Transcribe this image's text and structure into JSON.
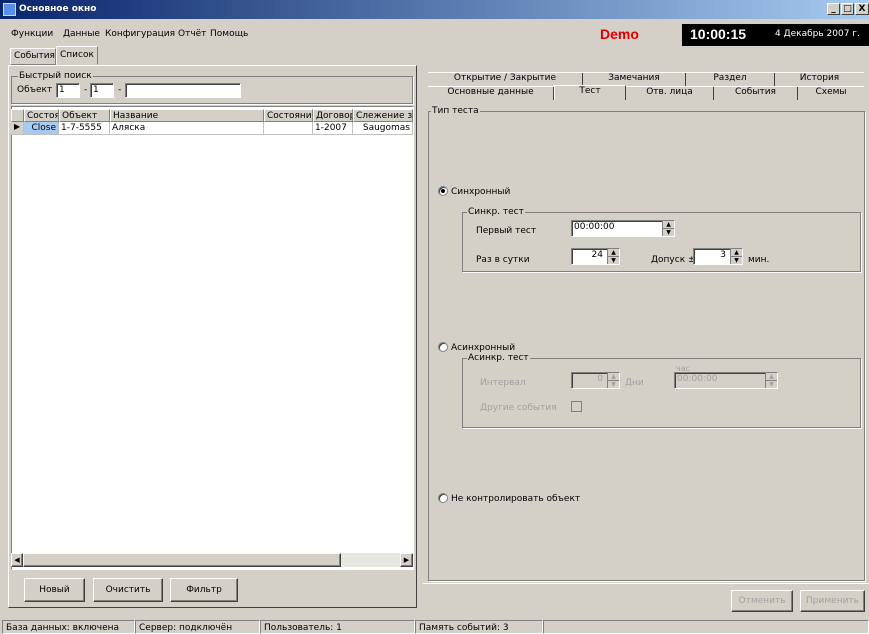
{
  "window": {
    "title": "Основное окно",
    "min": "_",
    "max": "□",
    "close": "X"
  },
  "menu": {
    "items": [
      "Функции",
      "Данные",
      "Конфигурация",
      "Отчёт",
      "Помощь"
    ]
  },
  "header": {
    "demo": "Demo",
    "time": "10:00:15",
    "date": "4 Декабрь 2007 г."
  },
  "view_tabs": [
    "События",
    "Список"
  ],
  "quick_search": {
    "legend": "Быстрый поиск",
    "label": "Объект",
    "f1": "1",
    "sep1": "-",
    "f2": "1",
    "sep2": "-",
    "f3": ""
  },
  "grid": {
    "columns": [
      "Состоя",
      "Объект",
      "Название",
      "Состояние",
      "Договор",
      "Слежение з"
    ],
    "rows": [
      [
        "Close",
        "1-7-5555",
        "Аляска",
        "",
        "1-2007",
        "Saugomas"
      ]
    ]
  },
  "left_buttons": {
    "new": "Новый",
    "clear": "Очистить",
    "filter": "Фильтр"
  },
  "right_tabs_row1": [
    "Открытие / Закрытие",
    "Замечания",
    "Раздел",
    "История"
  ],
  "right_tabs_row2": [
    "Основные данные",
    "Тест",
    "Отв. лица",
    "События",
    "Схемы"
  ],
  "test": {
    "type_legend": "Тип теста",
    "sync_label": "Синхронный",
    "sync_group": "Синкр. тест",
    "first_test_label": "Первый тест",
    "first_test_value": "00:00:00",
    "per_day_label": "Раз в сутки",
    "per_day_value": "24",
    "tolerance_label": "Допуск ±",
    "tolerance_value": "3",
    "minutes": "мин.",
    "async_label": "Асинхронный",
    "async_group": "Асинкр. тест",
    "interval_label": "Интервал",
    "interval_value": "0",
    "days": "Дни",
    "hour_label": "час",
    "hour_value": "00:00:00",
    "other_events": "Другие события",
    "no_control": "Не контролировать объект"
  },
  "right_buttons": {
    "cancel": "Отменить",
    "apply": "Применить"
  },
  "status": [
    "База данных: включена",
    "Сервер: подключён",
    "Пользователь: 1",
    "Память событий: 3"
  ]
}
